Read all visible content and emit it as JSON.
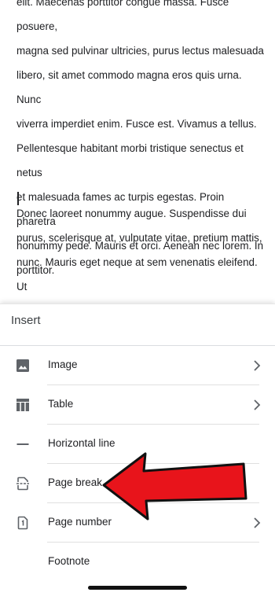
{
  "document": {
    "paragraph1": "elit. Maecenas porttitor congue massa. Fusce posuere,\nmagna sed pulvinar ultricies, purus lectus malesuada\nlibero, sit amet commodo magna eros quis urna. Nunc\nviverra imperdiet enim. Fusce est. Vivamus a tellus.\nPellentesque habitant morbi tristique senectus et netus\net malesuada fames ac turpis egestas. Proin pharetra\nnonummy pede. Mauris et orci. Aenean nec lorem. In\nporttitor.",
    "paragraph2": "Donec laoreet nonummy augue. Suspendisse dui\npurus, scelerisque at, vulputate vitae, pretium mattis,\nnunc. Mauris eget neque at sem venenatis eleifend. Ut\nnonummy. Fusce aliquet pede non pede. Suspendisse"
  },
  "insert_sheet": {
    "title": "Insert",
    "items": [
      {
        "label": "Image",
        "icon": "image-icon",
        "has_submenu": true
      },
      {
        "label": "Table",
        "icon": "table-icon",
        "has_submenu": true
      },
      {
        "label": "Horizontal line",
        "icon": "horizontal-line-icon",
        "has_submenu": false
      },
      {
        "label": "Page break",
        "icon": "page-break-icon",
        "has_submenu": false
      },
      {
        "label": "Page number",
        "icon": "page-number-icon",
        "has_submenu": true
      },
      {
        "label": "Footnote",
        "icon": "",
        "has_submenu": false
      }
    ]
  },
  "annotation": {
    "arrow_color": "#e8141b"
  },
  "colors": {
    "icon": "#5f6368",
    "text": "#202124"
  }
}
